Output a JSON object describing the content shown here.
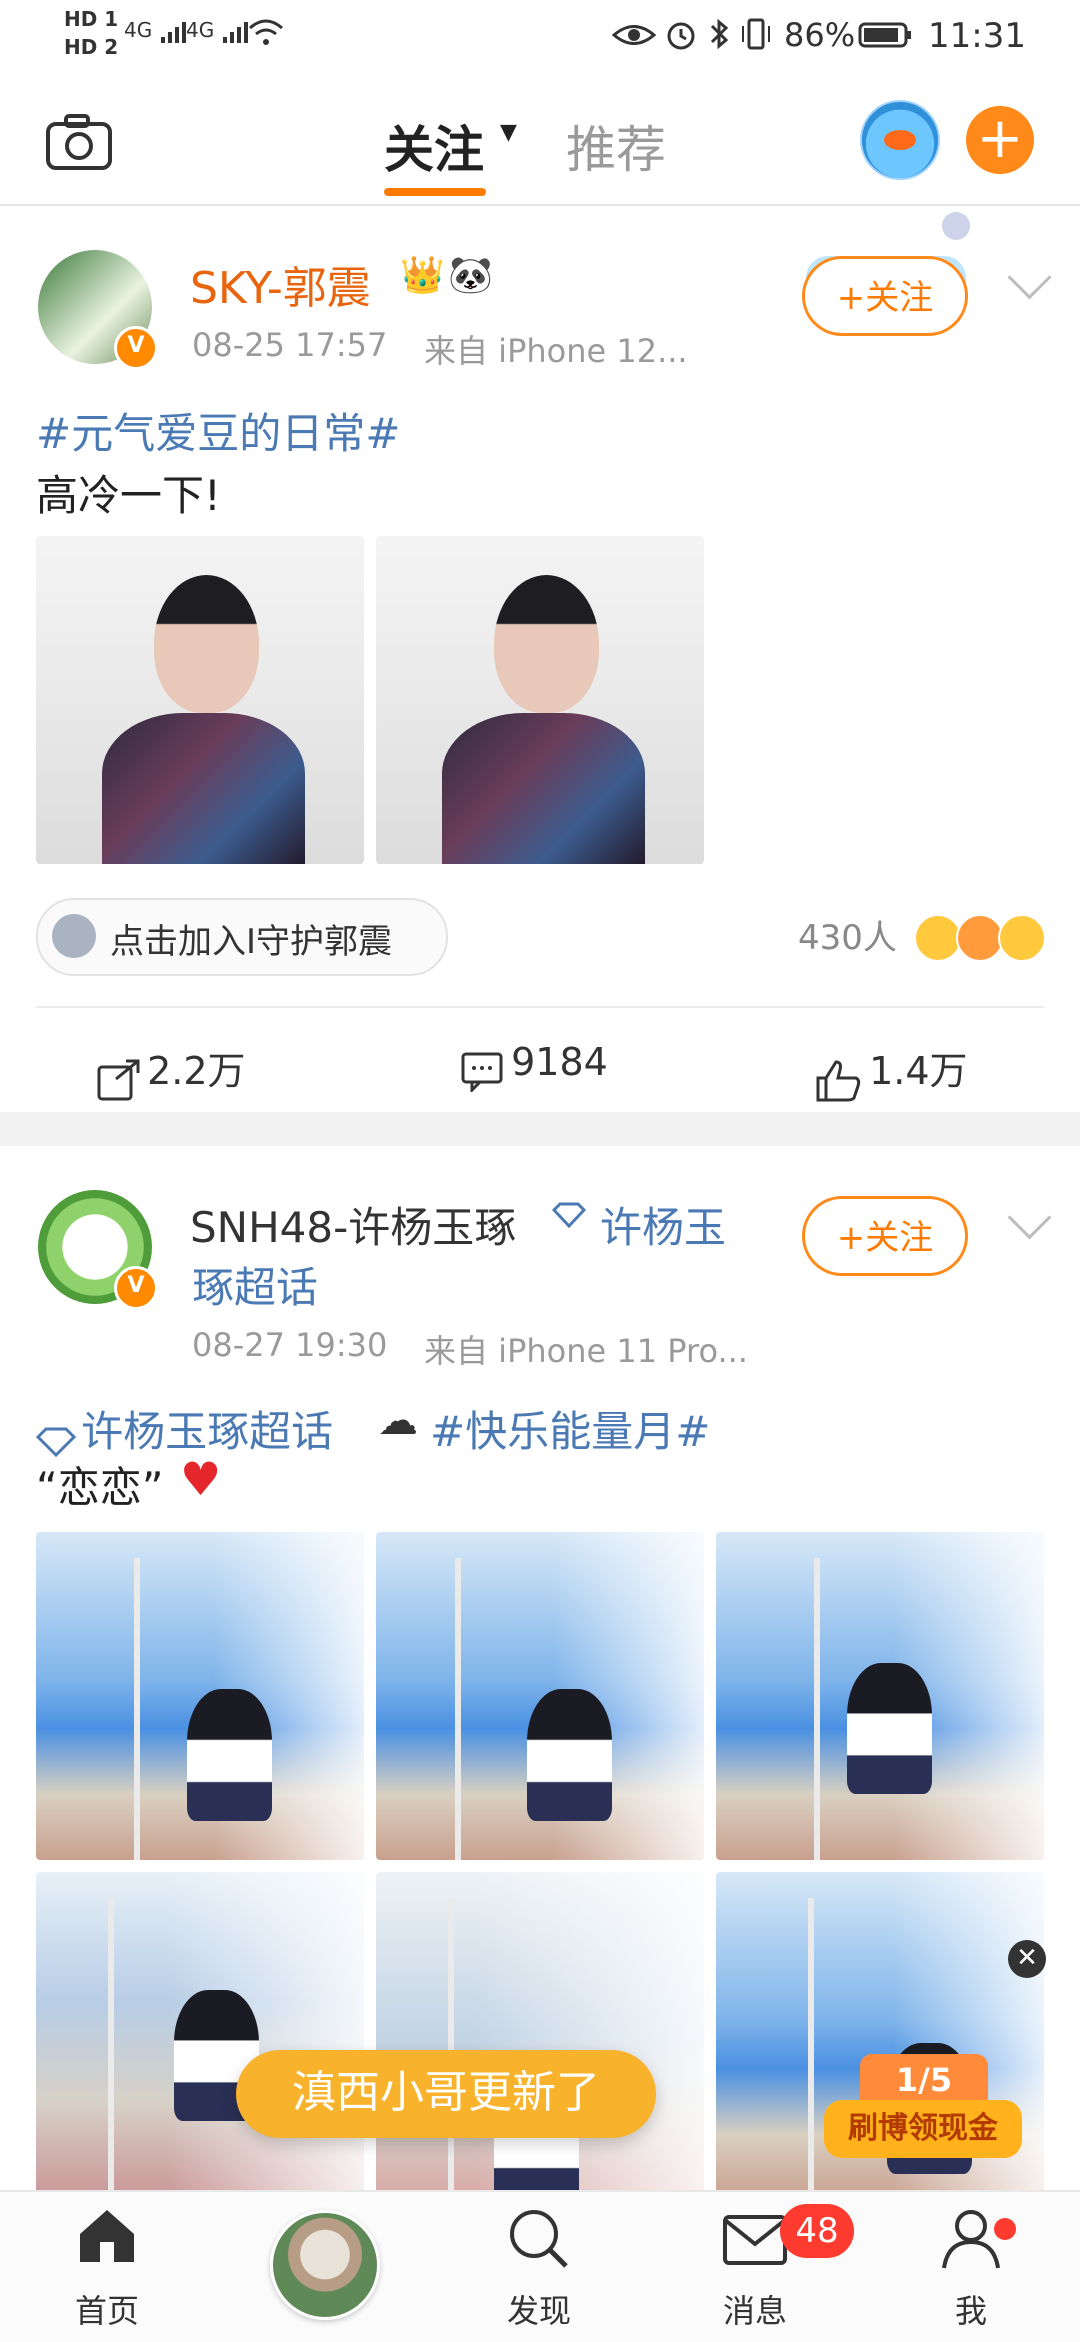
{
  "status_bar": {
    "left_labels": [
      "HD 1",
      "HD 2"
    ],
    "signal1": "4G",
    "signal2": "4G",
    "battery": "86%",
    "time": "11:31"
  },
  "top_nav": {
    "tab_follow": "关注",
    "tab_recommend": "推荐"
  },
  "posts": [
    {
      "author": "SKY-郭震",
      "time": "08-25 17:57",
      "source": "来自 iPhone 12...",
      "follow_label": "+关注",
      "tag": "#元气爱豆的日常#",
      "text": "高冷一下!",
      "guard_pill": "点击加入I守护郭震",
      "reactions_count": "430人",
      "actions": {
        "repost": "2.2万",
        "comment": "9184",
        "like": "1.4万"
      }
    },
    {
      "author": "SNH48-许杨玉琢",
      "super_topic_inline": "许杨玉",
      "super_topic_inline2": "琢超话",
      "time": "08-27 19:30",
      "source": "来自 iPhone 11 Pro...",
      "follow_label": "+关注",
      "tag1": "许杨玉琢超话",
      "tag2": "#快乐能量月#",
      "text": "“恋恋”"
    }
  ],
  "toast": "滇西小哥更新了",
  "promo": {
    "counter": "1/5",
    "label": "刷博领现金"
  },
  "tabbar": {
    "home": "首页",
    "discover": "发现",
    "messages": "消息",
    "messages_badge": "48",
    "me": "我"
  }
}
